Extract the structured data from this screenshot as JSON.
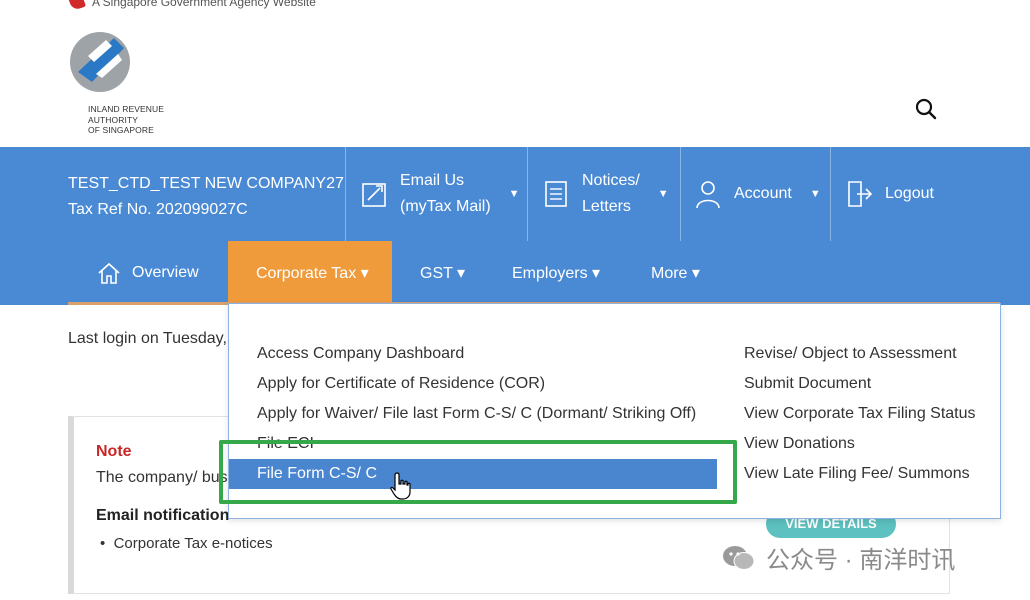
{
  "gov_banner": {
    "text": "A Singapore Government Agency Website"
  },
  "logo": {
    "lines": [
      "INLAND REVENUE",
      "AUTHORITY",
      "OF SINGAPORE"
    ]
  },
  "header": {
    "company_name": "TEST_CTD_TEST NEW COMPANY27",
    "tax_ref": "Tax Ref No. 202099027C",
    "email": {
      "line1": "Email Us",
      "line2": "(myTax Mail)",
      "icon": "email-icon"
    },
    "notices": {
      "line1": "Notices/",
      "line2": "Letters",
      "icon": "notices-icon"
    },
    "account": {
      "label": "Account",
      "icon": "user-icon"
    },
    "logout": {
      "label": "Logout",
      "icon": "logout-icon"
    },
    "caret": "▼"
  },
  "nav": {
    "overview": "Overview",
    "corporate_tax": "Corporate Tax ▾",
    "gst": "GST ▾",
    "employers": "Employers ▾",
    "more": "More ▾"
  },
  "main": {
    "last_login": "Last login on Tuesday,",
    "note_title": "Note",
    "note_text": "The company/ busi",
    "email_notification_title": "Email notification",
    "email_notification_item": "Corporate Tax e-notices",
    "view_details": "VIEW DETAILS"
  },
  "dropdown": {
    "left": [
      "Access Company Dashboard",
      "Apply for Certificate of Residence (COR)",
      "Apply for Waiver/ File last Form C-S/ C (Dormant/ Striking Off)",
      "File ECI"
    ],
    "highlighted": "File Form C-S/ C",
    "right": [
      "Revise/ Object to Assessment",
      "Submit Document",
      "View Corporate Tax Filing Status",
      "View Donations",
      "View Late Filing Fee/ Summons"
    ]
  },
  "watermark": {
    "text": "公众号 · 南洋时讯"
  },
  "colors": {
    "primary_blue": "#4a8ad4",
    "active_orange": "#ef9b3c",
    "highlight_blue": "#4a86d0",
    "annotation_green": "#35a84a",
    "note_red": "#c62828"
  }
}
